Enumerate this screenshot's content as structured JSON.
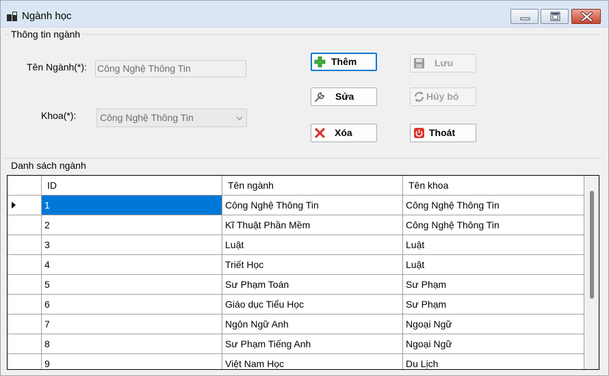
{
  "window": {
    "title": "Ngành học"
  },
  "info_group": {
    "title": "Thông tin ngành",
    "ten_nganh_label": "Tên Ngành(*):",
    "ten_nganh_value": "Công Nghệ Thông Tin",
    "khoa_label": "Khoa(*):",
    "khoa_value": "Công Nghệ Thông Tin"
  },
  "buttons": {
    "them": "Thêm",
    "luu": "Lưu",
    "sua": "Sửa",
    "huy_bo": "Hủy bỏ",
    "xoa": "Xóa",
    "thoat": "Thoát"
  },
  "list_group": {
    "title": "Danh sách ngành"
  },
  "grid": {
    "columns": [
      "ID",
      "Tên ngành",
      "Tên khoa"
    ],
    "rows": [
      {
        "id": "1",
        "ten_nganh": "Công Nghệ Thông Tin",
        "ten_khoa": "Công Nghệ Thông Tin"
      },
      {
        "id": "2",
        "ten_nganh": "Kĩ Thuật Phần Mềm",
        "ten_khoa": "Công Nghệ Thông Tin"
      },
      {
        "id": "3",
        "ten_nganh": "Luật",
        "ten_khoa": "Luật"
      },
      {
        "id": "4",
        "ten_nganh": "Triết Học",
        "ten_khoa": "Luật"
      },
      {
        "id": "5",
        "ten_nganh": "Sư Phạm Toán",
        "ten_khoa": "Sư Phạm"
      },
      {
        "id": "6",
        "ten_nganh": "Giáo dục Tiểu Học",
        "ten_khoa": "Sư Phạm"
      },
      {
        "id": "7",
        "ten_nganh": "Ngôn Ngữ Anh",
        "ten_khoa": "Ngoại Ngữ"
      },
      {
        "id": "8",
        "ten_nganh": "Sư Phạm Tiếng Anh",
        "ten_khoa": "Ngoại Ngữ"
      },
      {
        "id": "9",
        "ten_nganh": "Việt Nam Học",
        "ten_khoa": "Du Lịch"
      }
    ],
    "selected_row": 0
  },
  "colors": {
    "selection": "#0078d7",
    "titlebar": "#dae6f4",
    "close_button": "#c74631"
  }
}
